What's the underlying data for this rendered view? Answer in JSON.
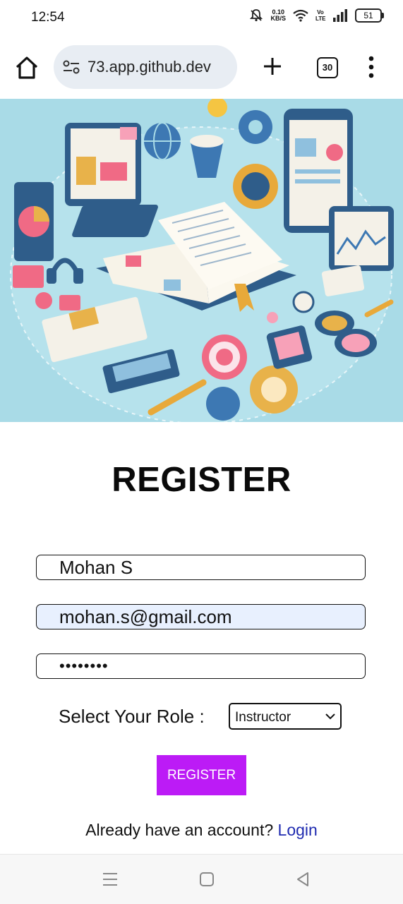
{
  "status_bar": {
    "time": "12:54",
    "net_speed_value": "0.10",
    "net_speed_unit": "KB/S",
    "network_label": "Vo LTE",
    "battery": "51",
    "icons": [
      "mute-icon",
      "wifi-icon",
      "signal-icon",
      "battery-icon"
    ]
  },
  "browser": {
    "url": "73.app.github.dev",
    "tab_count": "30",
    "icons": [
      "home-icon",
      "site-settings-icon",
      "new-tab-icon",
      "menu-icon"
    ]
  },
  "hero": {
    "description_icon": "education-illustration",
    "bg_color": "#a8dbe6"
  },
  "form": {
    "title": "REGISTER",
    "name_value": "Mohan S",
    "email_value": "mohan.s@gmail.com",
    "password_value": "••••••••",
    "role_label": "Select Your Role :",
    "role_selected": "Instructor",
    "submit_label": "REGISTER",
    "submit_color": "#bc1bf6",
    "login_prompt": "Already have an account?",
    "login_link": "Login",
    "link_color": "#1f2bb0"
  },
  "nav_bar": {
    "icons": [
      "recents-icon",
      "home-icon",
      "back-icon"
    ]
  }
}
